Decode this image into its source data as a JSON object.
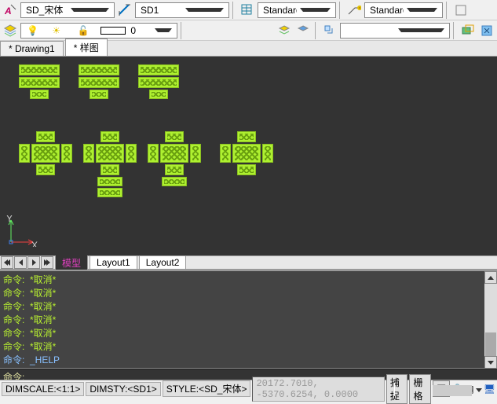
{
  "top_toolbar": {
    "font_style": "SD_宋体",
    "dim_style": "SD1",
    "text_std1": "Standard",
    "text_std2": "Standard"
  },
  "layer_toolbar": {
    "layer_value": "0"
  },
  "tabs": {
    "items": [
      "* Drawing1",
      "* 样图"
    ],
    "active_index": 1
  },
  "ucs": {
    "x": "X",
    "y": "Y"
  },
  "layout_tabs": {
    "items": [
      "模型",
      "Layout1",
      "Layout2"
    ],
    "active_index": 0
  },
  "command": {
    "history": [
      "命令:  *取消*",
      "命令:  *取消*",
      "命令:  *取消*",
      "命令:  *取消*",
      "命令:  *取消*",
      "命令:  *取消*"
    ],
    "help_line": "命令:  _HELP",
    "prompt": "命令: "
  },
  "status": {
    "dimscale": "DIMSCALE:<1:1>",
    "dimsty": "DIMSTY:<SD1>",
    "style": "STYLE:<SD_宋体>",
    "coords": "20172.7010,   -5370.6254, 0.0000",
    "snap": "捕捉",
    "grid": "栅格",
    "ortho": "正"
  }
}
